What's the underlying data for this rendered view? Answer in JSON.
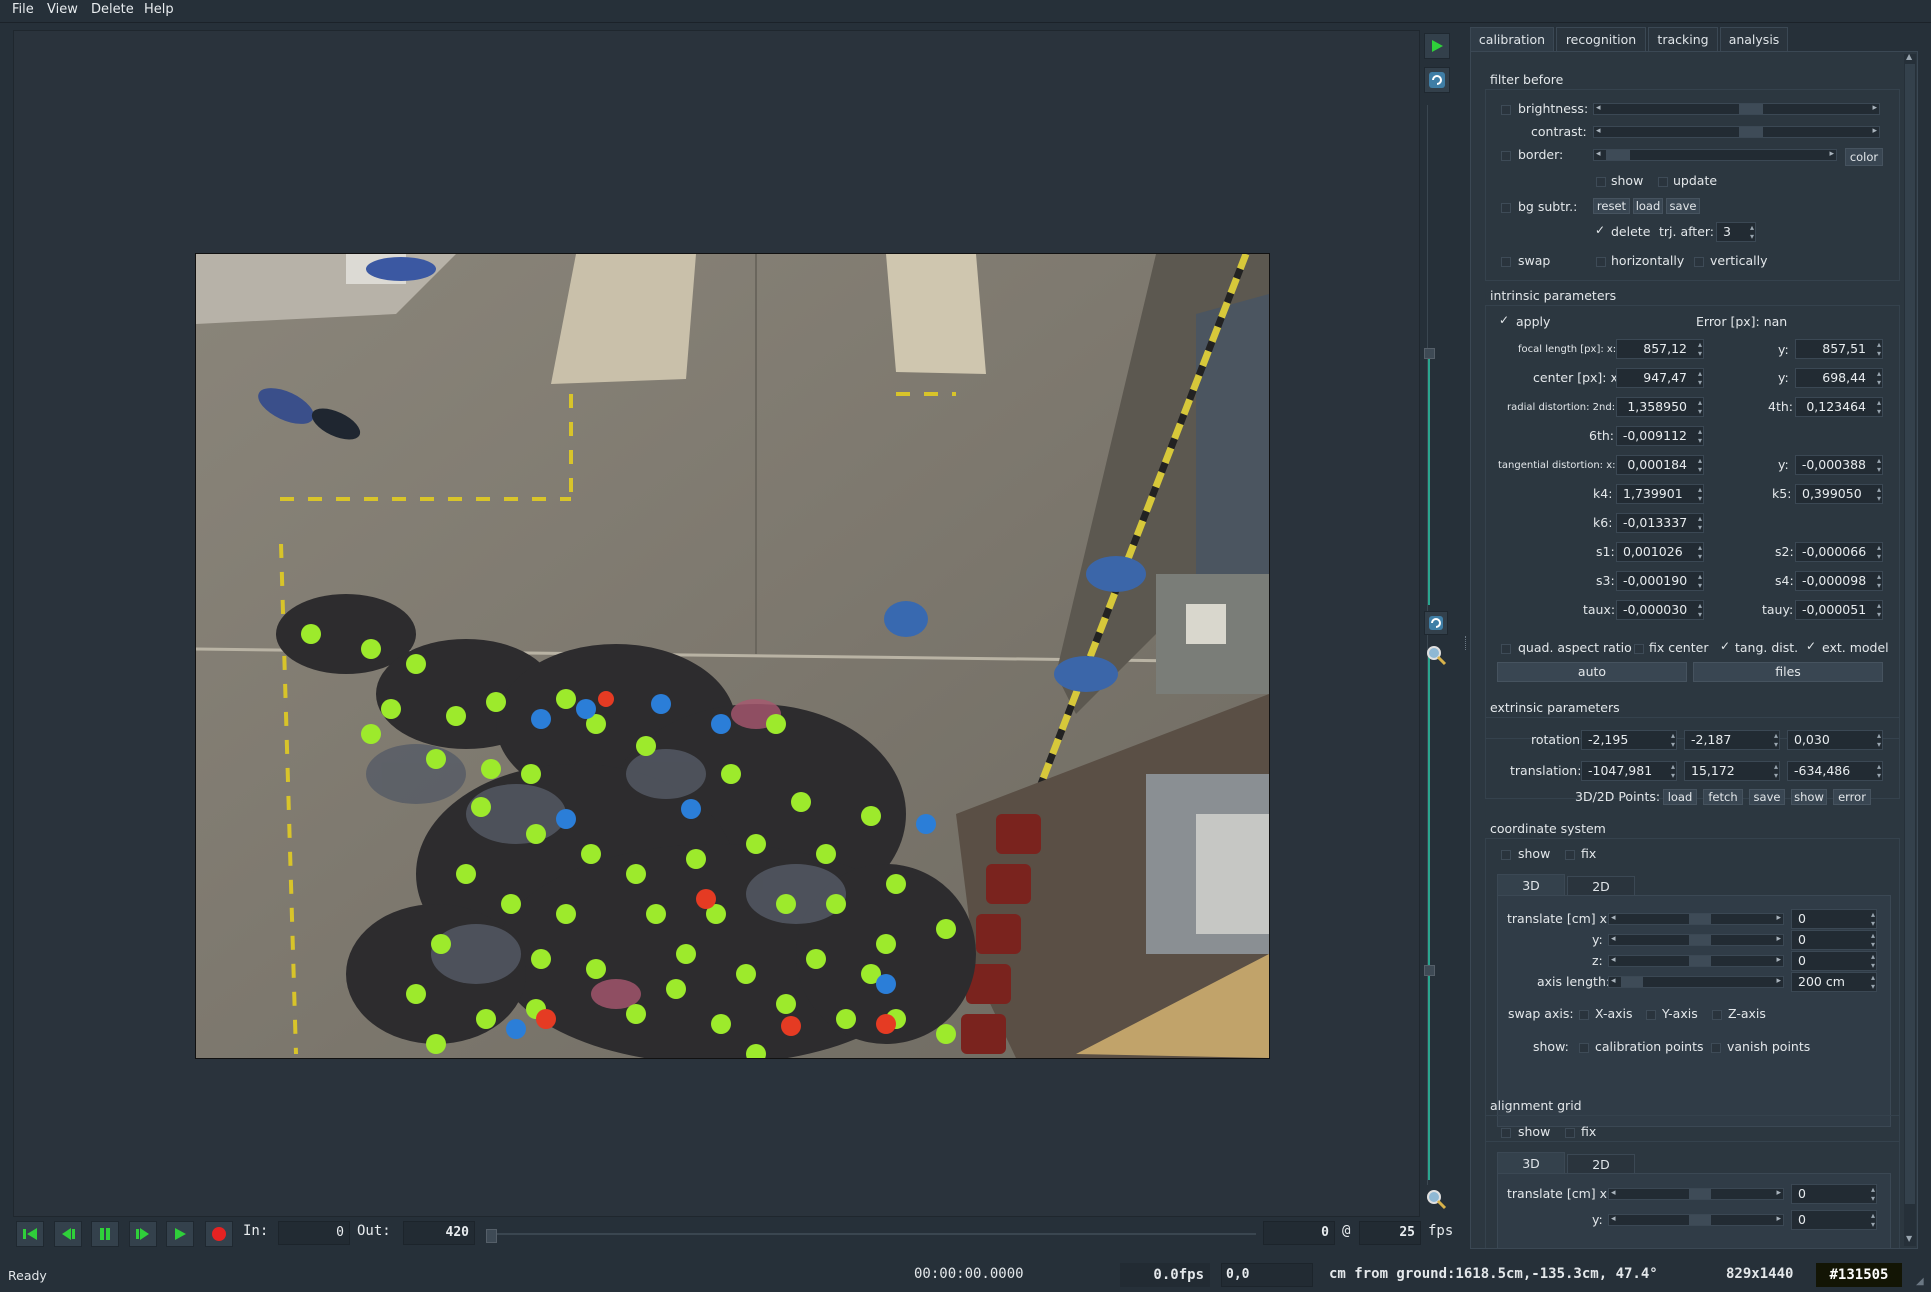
{
  "menu": {
    "items": [
      "File",
      "View",
      "Delete",
      "Help"
    ]
  },
  "tabs": [
    "calibration",
    "recognition",
    "tracking",
    "analysis"
  ],
  "filter_before": {
    "title": "filter before",
    "brightness": "brightness:",
    "contrast": "contrast:",
    "border": "border:",
    "color_btn": "color",
    "show": "show",
    "update": "update",
    "bg_subtr": "bg subtr.:",
    "reset": "reset",
    "load": "load",
    "save": "save",
    "delete": "delete",
    "trj_after": "trj. after:",
    "trj_after_value": "3",
    "swap": "swap",
    "horizontally": "horizontally",
    "vertically": "vertically"
  },
  "intrinsic": {
    "title": "intrinsic parameters",
    "apply": "apply",
    "error": "Error [px]: nan",
    "focal_label": "focal length [px]: x:",
    "focal_x": "857,12",
    "focal_y": "857,51",
    "center_label": "center [px]: x:",
    "center_x": "947,47",
    "center_y": "698,44",
    "radial_label": "radial distortion: 2nd:",
    "radial_2nd": "1,358950",
    "fourth_label": "4th:",
    "radial_4th": "0,123464",
    "sixth_label": "6th:",
    "radial_6th": "-0,009112",
    "tangential_label": "tangential distortion: x:",
    "tang_x": "0,000184",
    "tang_y": "-0,000388",
    "y_label": "y:",
    "k4_label": "k4:",
    "k4": "1,739901",
    "k5_label": "k5:",
    "k5": "0,399050",
    "k6_label": "k6:",
    "k6": "-0,013337",
    "s1_label": "s1:",
    "s1": "0,001026",
    "s2_label": "s2:",
    "s2": "-0,000066",
    "s3_label": "s3:",
    "s3": "-0,000190",
    "s4_label": "s4:",
    "s4": "-0,000098",
    "taux_label": "taux:",
    "taux": "-0,000030",
    "tauy_label": "tauy:",
    "tauy": "-0,000051",
    "quad": "quad. aspect ratio",
    "fix_center": "fix center",
    "tang_dist": "tang. dist.",
    "ext_model": "ext. model",
    "auto": "auto",
    "files": "files"
  },
  "extrinsic": {
    "title": "extrinsic parameters",
    "rotation_label": "rotation:",
    "rotation": [
      "-2,195",
      "-2,187",
      "0,030"
    ],
    "translation_label": "translation:",
    "translation": [
      "-1047,981",
      "15,172",
      "-634,486"
    ],
    "points_label": "3D/2D Points:",
    "buttons": [
      "load",
      "fetch",
      "save",
      "show",
      "error"
    ]
  },
  "coordinate_system": {
    "title": "coordinate system",
    "show": "show",
    "fix": "fix",
    "tab3d": "3D",
    "tab2d": "2D",
    "translate_label": "translate [cm] x:",
    "y_label": "y:",
    "z_label": "z:",
    "tx": "0",
    "ty": "0",
    "tz": "0",
    "axis_length_label": "axis length:",
    "axis_length": "200 cm",
    "swap_axis": "swap axis:",
    "x_axis": "X-axis",
    "y_axis": "Y-axis",
    "z_axis": "Z-axis",
    "show_label": "show:",
    "calibration_points": "calibration points",
    "vanish_points": "vanish points"
  },
  "alignment_grid": {
    "title": "alignment grid",
    "show": "show",
    "fix": "fix",
    "tab3d": "3D",
    "tab2d": "2D",
    "translate_label": "translate [cm] x:",
    "y_label": "y:",
    "tx": "0",
    "ty": "0"
  },
  "playback": {
    "in_label": "In:",
    "in_value": "0",
    "out_label": "Out:",
    "out_value": "420",
    "frame": "0",
    "at": "@",
    "fps_value": "25",
    "fps_label": "fps"
  },
  "status": {
    "ready": "Ready",
    "time": "00:00:00.0000",
    "fps": "0.0fps",
    "pos": "0,0",
    "ground": "cm from ground:1618.5cm,-135.3cm, 47.4°",
    "size": "829x1440",
    "color": "#131505"
  },
  "colors": {
    "accent_teal": "#2aa58f",
    "head_green": "#9dea2c",
    "head_blue": "#2b7ed8",
    "head_red": "#e53b23",
    "record_red": "#e52222"
  }
}
